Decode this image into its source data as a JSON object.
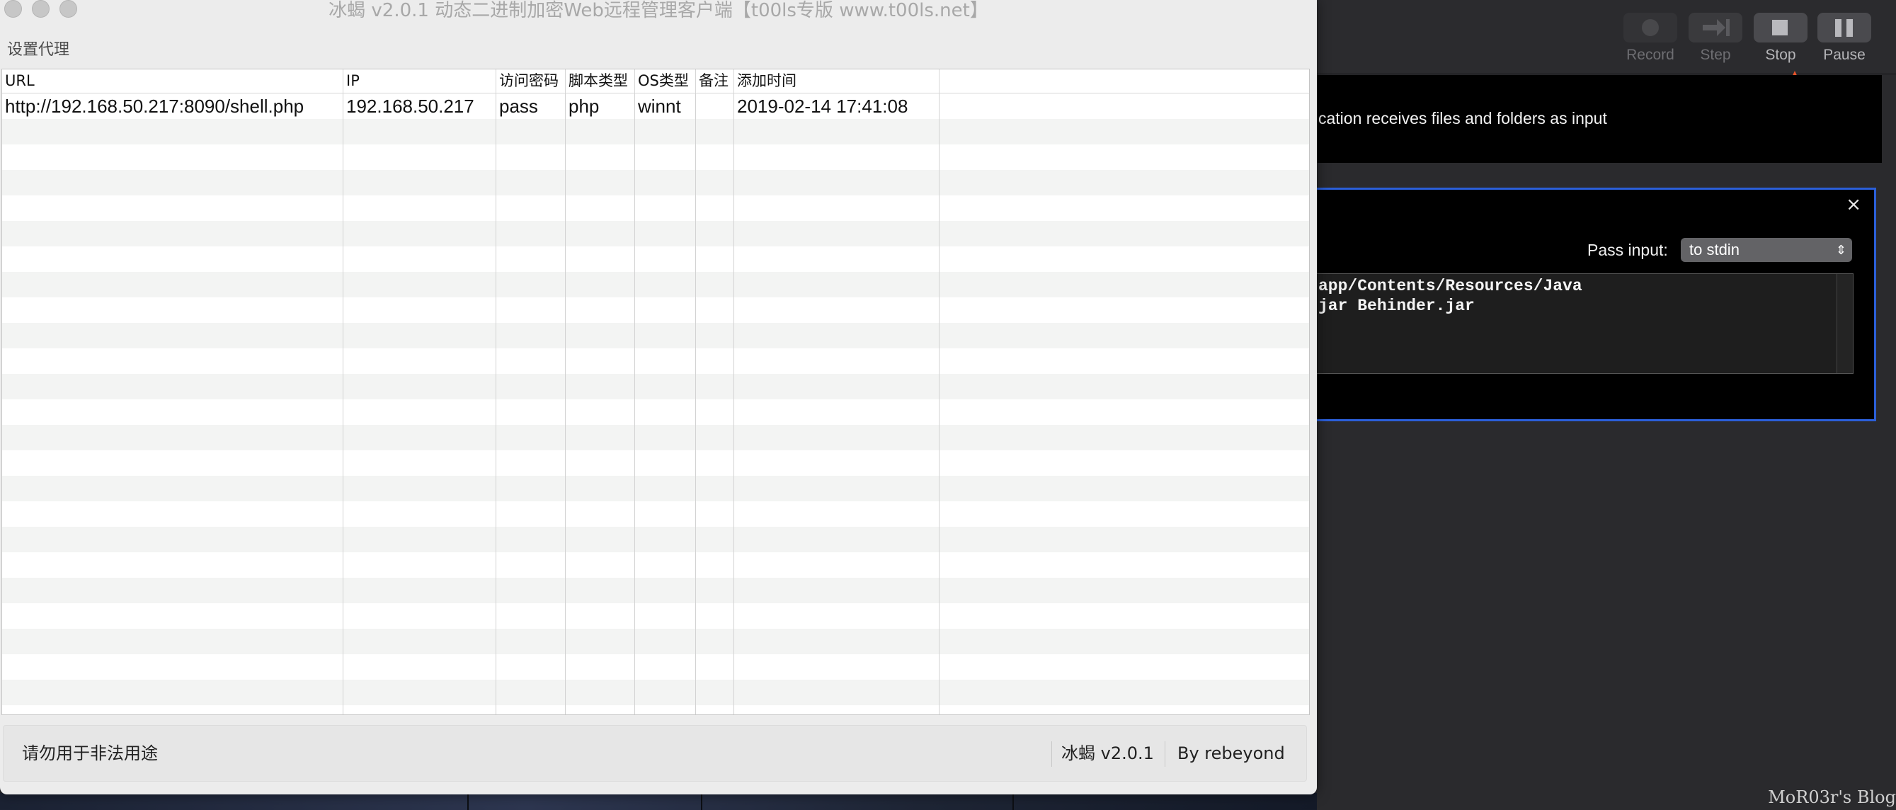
{
  "window": {
    "title": "冰蝎 v2.0.1 动态二进制加密Web远程管理客户端【t00ls专版 www.t00ls.net】"
  },
  "menu": {
    "proxy_label": "设置代理"
  },
  "table": {
    "columns": [
      "URL",
      "IP",
      "访问密码",
      "脚本类型",
      "OS类型",
      "备注",
      "添加时间"
    ],
    "rows": [
      [
        "http://192.168.50.217:8090/shell.php",
        "192.168.50.217",
        "pass",
        "php",
        "winnt",
        "",
        "2019-02-14 17:41:08"
      ]
    ]
  },
  "status": {
    "warning": "请勿用于非法用途",
    "version": "冰蝎 v2.0.1",
    "author": "By rebeyond"
  },
  "automator": {
    "toolbar": {
      "record": "Record",
      "step": "Step",
      "stop": "Stop",
      "pause": "Pause"
    },
    "description": "cation receives files and folders as input",
    "action": {
      "close": "×",
      "pass_input_label": "Pass input:",
      "pass_input_value": "to stdin",
      "script_lines": [
        "app/Contents/Resources/Java",
        "jar Behinder.jar"
      ]
    }
  },
  "watermark": "MoR03r's Blog",
  "colors": {
    "window_bg": "#ececec",
    "row_stripe": "#f3f4f3",
    "automator_bg": "#2a2a2d",
    "card_border": "#2b5fd9",
    "arrow": "#e8542a"
  }
}
